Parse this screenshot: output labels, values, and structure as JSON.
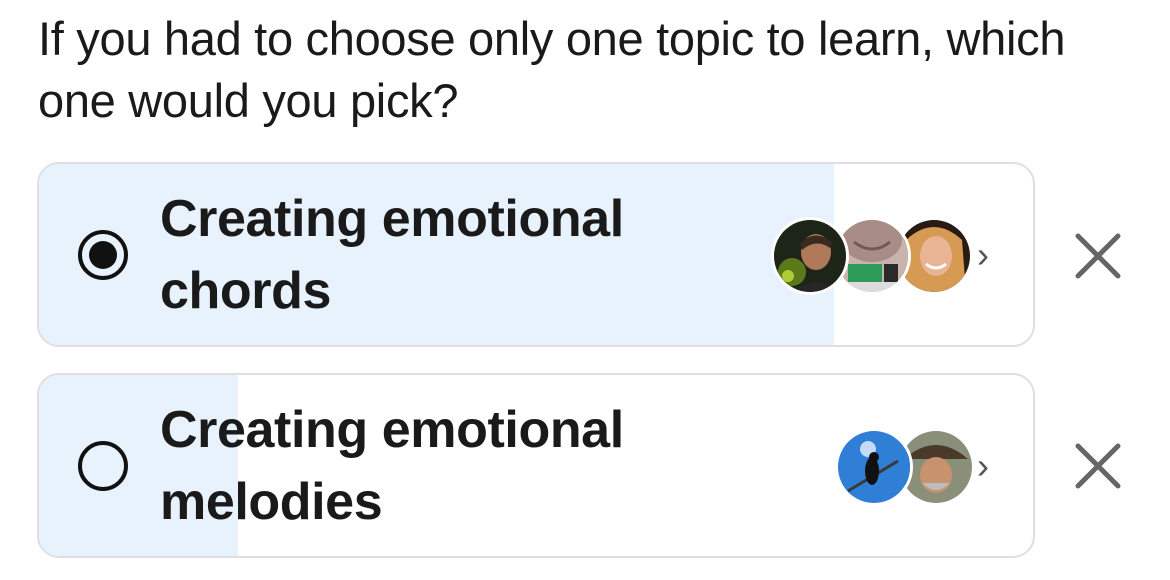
{
  "question": "If you had to choose only one topic to learn, which one would you pick?",
  "options": [
    {
      "label": "Creating emotional chords",
      "selected": true,
      "vote_share": 0.8,
      "voters": [
        "voter-avatar-1",
        "voter-avatar-2",
        "voter-avatar-3"
      ],
      "remove_icon": "close-icon",
      "more_icon": "chevron-right-icon"
    },
    {
      "label": "Creating emotional melodies",
      "selected": false,
      "vote_share": 0.2,
      "voters": [
        "voter-avatar-1",
        "voter-avatar-2"
      ],
      "remove_icon": "close-icon",
      "more_icon": "chevron-right-icon"
    }
  ],
  "chevron_glyph": "›",
  "colors": {
    "fill": "#e8f2fd",
    "border": "#dedfe3",
    "text": "#1a1a1a"
  }
}
